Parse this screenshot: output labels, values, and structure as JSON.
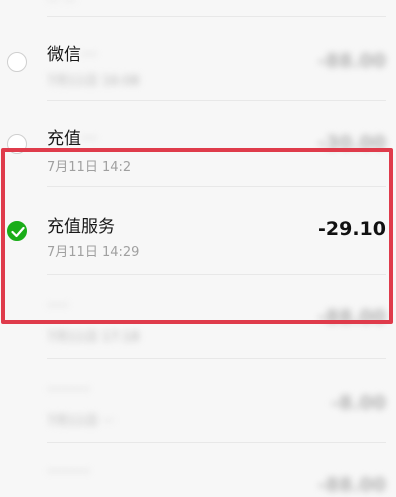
{
  "top_partial": {
    "label": "··· ···"
  },
  "rows": [
    {
      "title": "微信",
      "title_redacted": "···",
      "time": "7月11日 16:08",
      "amount": "-88.00",
      "selected": false,
      "blurred_amount": true
    },
    {
      "title": "充值",
      "title_redacted": "···",
      "time": "7月11日 14:2",
      "amount": "-30.00",
      "selected": false,
      "blurred_amount": true
    },
    {
      "title": "充值服务",
      "time": "7月11日 14:29",
      "amount": "-29.10",
      "selected": true
    },
    {
      "title": "····",
      "time": "7月11日 17:18",
      "amount": "-88.00",
      "selected": false,
      "blurred_amount": true
    },
    {
      "title": "········",
      "time": "7月11日 ···",
      "amount": "-8.00",
      "selected": false,
      "blurred_amount": true
    },
    {
      "title": "········",
      "time": "······",
      "amount": "-88.00",
      "selected": false,
      "blurred_amount": true
    }
  ],
  "colors": {
    "accent_green": "#1aad19",
    "highlight_red": "#df3b4b",
    "background": "#f7f7f7"
  }
}
